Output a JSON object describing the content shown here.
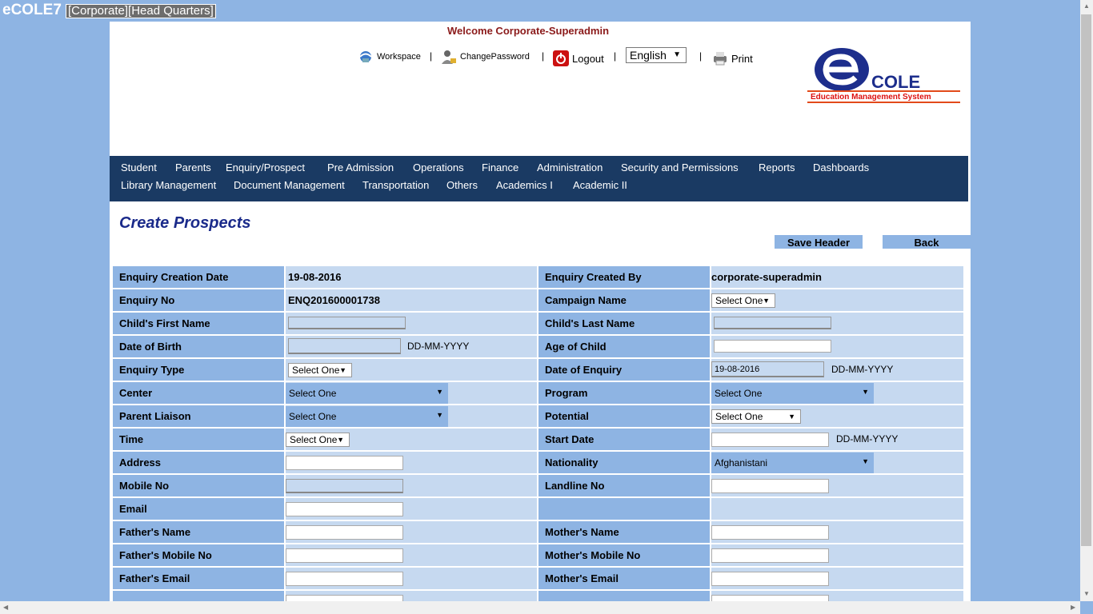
{
  "app": {
    "title": "eCOLE7",
    "context": "[Corporate][Head Quarters]"
  },
  "header": {
    "welcome": "Welcome Corporate-Superadmin",
    "links": {
      "workspace": "Workspace",
      "change_password": "ChangePassword",
      "logout": "Logout",
      "print": "Print"
    },
    "separator": "|",
    "language": "English",
    "logo": {
      "brand": "COLE",
      "tagline": "Education Management System"
    }
  },
  "menu": {
    "row1": [
      "Student",
      "Parents",
      "Enquiry/Prospect",
      "Pre Admission",
      "Operations",
      "Finance",
      "Administration",
      "Security and Permissions",
      "Reports",
      "Dashboards"
    ],
    "row2": [
      "Library Management",
      "Document Management",
      "Transportation",
      "Others",
      "Academics I",
      "Academic II"
    ]
  },
  "page": {
    "heading": "Create Prospects",
    "save_header": "Save Header",
    "back": "Back"
  },
  "form": {
    "date_hint": "DD-MM-YYYY",
    "labels": {
      "enquiry_creation_date": "Enquiry Creation Date",
      "enquiry_created_by": "Enquiry Created By",
      "enquiry_no": "Enquiry No",
      "campaign_name": "Campaign Name",
      "child_first_name": "Child's First Name",
      "child_last_name": "Child's Last Name",
      "date_of_birth": "Date of Birth",
      "age_of_child": "Age of Child",
      "enquiry_type": "Enquiry Type",
      "date_of_enquiry": "Date of Enquiry",
      "center": "Center",
      "program": "Program",
      "parent_liaison": "Parent Liaison",
      "potential": "Potential",
      "time": "Time",
      "start_date": "Start Date",
      "address": "Address",
      "nationality": "Nationality",
      "mobile_no": "Mobile No",
      "landline_no": "Landline No",
      "email": "Email",
      "fathers_name": "Father's Name",
      "mothers_name": "Mother's Name",
      "fathers_mobile": "Father's Mobile No",
      "mothers_mobile": "Mother's Mobile No",
      "fathers_email": "Father's Email",
      "mothers_email": "Mother's Email"
    },
    "values": {
      "enquiry_creation_date": "19-08-2016",
      "enquiry_created_by": "corporate-superadmin",
      "enquiry_no": "ENQ201600001738",
      "date_of_enquiry": "19-08-2016",
      "select_one": "Select One",
      "nationality": "Afghanistani"
    }
  },
  "colors": {
    "background": "#8eb4e3",
    "menu": "#1a3a63",
    "label_cell": "#8eb4e3",
    "value_cell": "#c6d9f0",
    "heading": "#1a2a8a",
    "welcome": "#8b1a1a"
  }
}
